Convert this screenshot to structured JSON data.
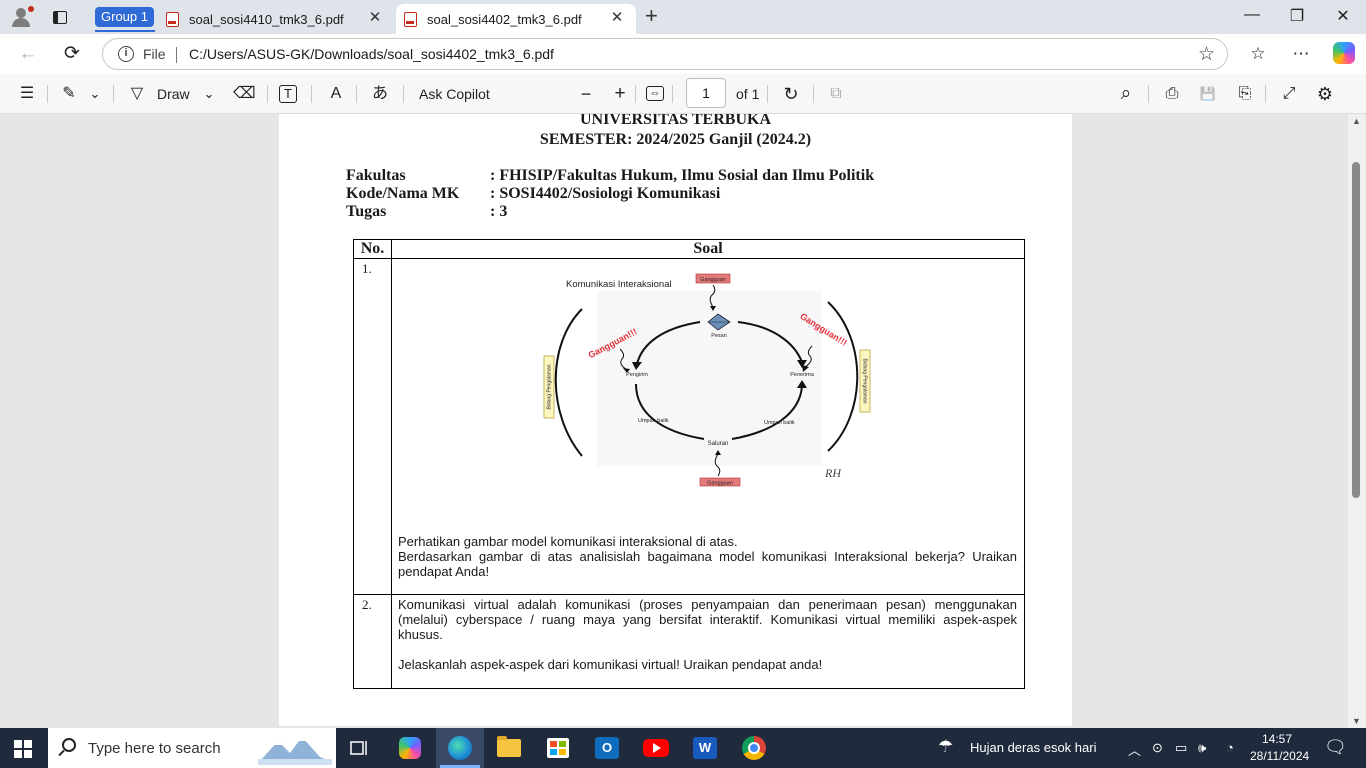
{
  "browser": {
    "group_label": "Group 1",
    "tabs": [
      {
        "title": "soal_sosi4410_tmk3_6.pdf",
        "close": "✕"
      },
      {
        "title": "soal_sosi4402_tmk3_6.pdf",
        "close": "✕"
      }
    ],
    "new_tab": "+",
    "window_controls": {
      "minimize": "—",
      "restore": "❐",
      "close": "✕"
    },
    "nav": {
      "back": "←",
      "refresh": "⟳"
    },
    "address": {
      "info": "i",
      "file_label": "File",
      "url": "C:/Users/ASUS-GK/Downloads/soal_sosi4402_tmk3_6.pdf",
      "star": "☆"
    },
    "right_icons": {
      "favorites": "☆",
      "more": "⋯"
    }
  },
  "pdf_toolbar": {
    "contents": "☰",
    "highlight": "✎",
    "draw_label": "Draw",
    "chevron": "⌄",
    "erase": "⌫",
    "textbox": "T",
    "read_aloud": "A",
    "translate": "あ",
    "ask_copilot": "Ask Copilot",
    "zoom_out": "−",
    "zoom_in": "+",
    "fit": "⇔",
    "page_current": "1",
    "page_of": "of 1",
    "rotate": "↻",
    "two_page": "⧉",
    "search": "⌕",
    "print": "⎙",
    "save": "💾",
    "save_as": "⎘",
    "fullscreen": "⤢",
    "settings": "⚙"
  },
  "document": {
    "university": "UNIVERSITAS TERBUKA",
    "semester": "SEMESTER: 2024/2025 Ganjil (2024.2)",
    "meta": [
      {
        "label": "Fakultas",
        "value": ": FHISIP/Fakultas Hukum, Ilmu Sosial dan Ilmu Politik"
      },
      {
        "label": "Kode/Nama MK",
        "value": ": SOSI4402/Sosiologi Komunikasi"
      },
      {
        "label": "Tugas",
        "value": ": 3"
      }
    ],
    "table_headers": {
      "no": "No.",
      "soal": "Soal"
    },
    "diagram": {
      "title": "Komunikasi Interaksional",
      "gangguan_top": "Gangguan",
      "gangguan_bottom": "Gangguan",
      "gangguan_left": "Gangguan!!!",
      "gangguan_right": "Gangguan!!!",
      "pesan": "Pesan",
      "pengirim": "Pengirim",
      "penerima": "Penerima",
      "umpan_balik_left": "Umpan balik",
      "umpan_balik_right": "Umpan balik",
      "saluran": "Saluran",
      "bidang_left": "Bidang Pengalaman",
      "bidang_right": "Bidang Pengalaman",
      "signature": "RH"
    },
    "questions": [
      {
        "no": "1.",
        "text_line1": "Perhatikan gambar model komunikasi interaksional di atas.",
        "text_line2": "Berdasarkan gambar di atas analisislah bagaimana model komunikasi Interaksional bekerja? Uraikan pendapat Anda!"
      },
      {
        "no": "2.",
        "text_line1": "Komunikasi virtual adalah komunikasi (proses penyampaian dan penerimaan pesan) menggunakan (melalui) cyberspace / ruang maya yang bersifat interaktif. Komunikasi virtual memiliki aspek-aspek khusus.",
        "text_line2": "Jelaskanlah aspek-aspek dari komunikasi virtual! Uraikan pendapat anda!"
      }
    ]
  },
  "taskbar": {
    "search_placeholder": "Type here to search",
    "weather": "Hujan deras esok hari",
    "time": "14:57",
    "date": "28/11/2024"
  }
}
